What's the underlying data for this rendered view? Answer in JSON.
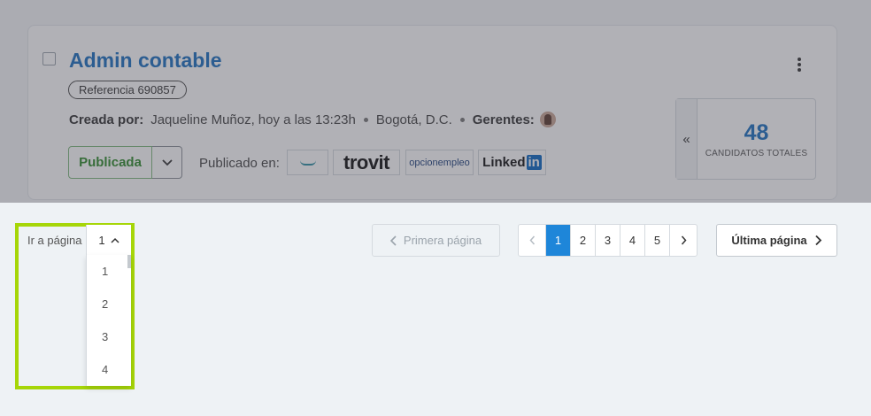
{
  "job": {
    "title": "Admin contable",
    "reference": "Referencia 690857",
    "created_by_label": "Creada por:",
    "creator": "Jaqueline Muñoz,",
    "time": "hoy a las 13:23h",
    "location": "Bogotá, D.C.",
    "managers_label": "Gerentes:",
    "status": "Publicada",
    "published_in_label": "Publicado en:",
    "portals": {
      "p2": "trovit",
      "p3": "opcionempleo",
      "p4_text": "Linked",
      "p4_in": "in"
    },
    "candidates": {
      "count": "48",
      "label": "CANDIDATOS TOTALES",
      "toggle": "«"
    }
  },
  "pagination": {
    "goto_label": "Ir a página",
    "selected_page": "1",
    "options": [
      "1",
      "2",
      "3",
      "4"
    ],
    "first_label": "Primera página",
    "pages": [
      "1",
      "2",
      "3",
      "4",
      "5"
    ],
    "current_page": "1",
    "last_label": "Última página"
  },
  "colors": {
    "accent": "#1e86d9",
    "highlight": "#a6d608",
    "status": "#2e8a2a",
    "title": "#1a6fbf"
  }
}
